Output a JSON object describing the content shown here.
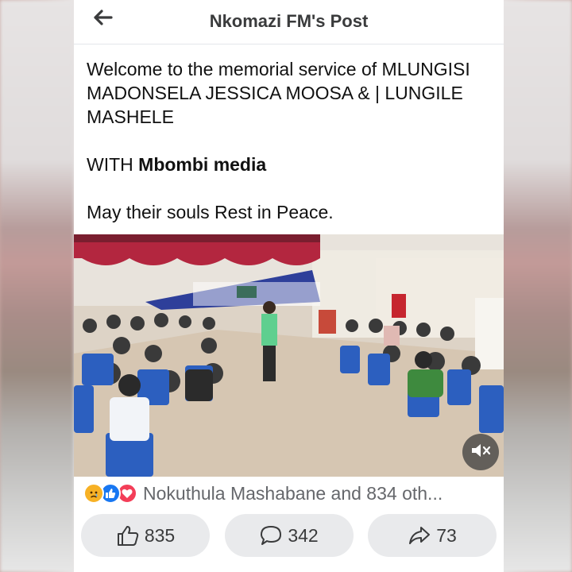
{
  "header": {
    "title": "Nkomazi FM's Post",
    "back_icon": "arrow-left-icon"
  },
  "post": {
    "line1": "Welcome to the memorial service of MLUNGISI MADONSELA JESSICA MOOSA & | LUNGILE MASHELE",
    "with_prefix": "WITH ",
    "with_name": "Mbombi media",
    "closing": "May their souls Rest in Peace."
  },
  "video": {
    "mute_icon": "muted-speaker-icon"
  },
  "reactions": {
    "icons": [
      "sad-icon",
      "like-icon",
      "love-icon"
    ],
    "summary": "Nokuthula Mashabane and 834 oth..."
  },
  "actions": {
    "like_count": "835",
    "comment_count": "342",
    "share_count": "73"
  },
  "colors": {
    "like_blue": "#1877f2",
    "love_red": "#f33e58",
    "sad_yellow": "#f7b125",
    "button_bg": "#e9eaec"
  }
}
